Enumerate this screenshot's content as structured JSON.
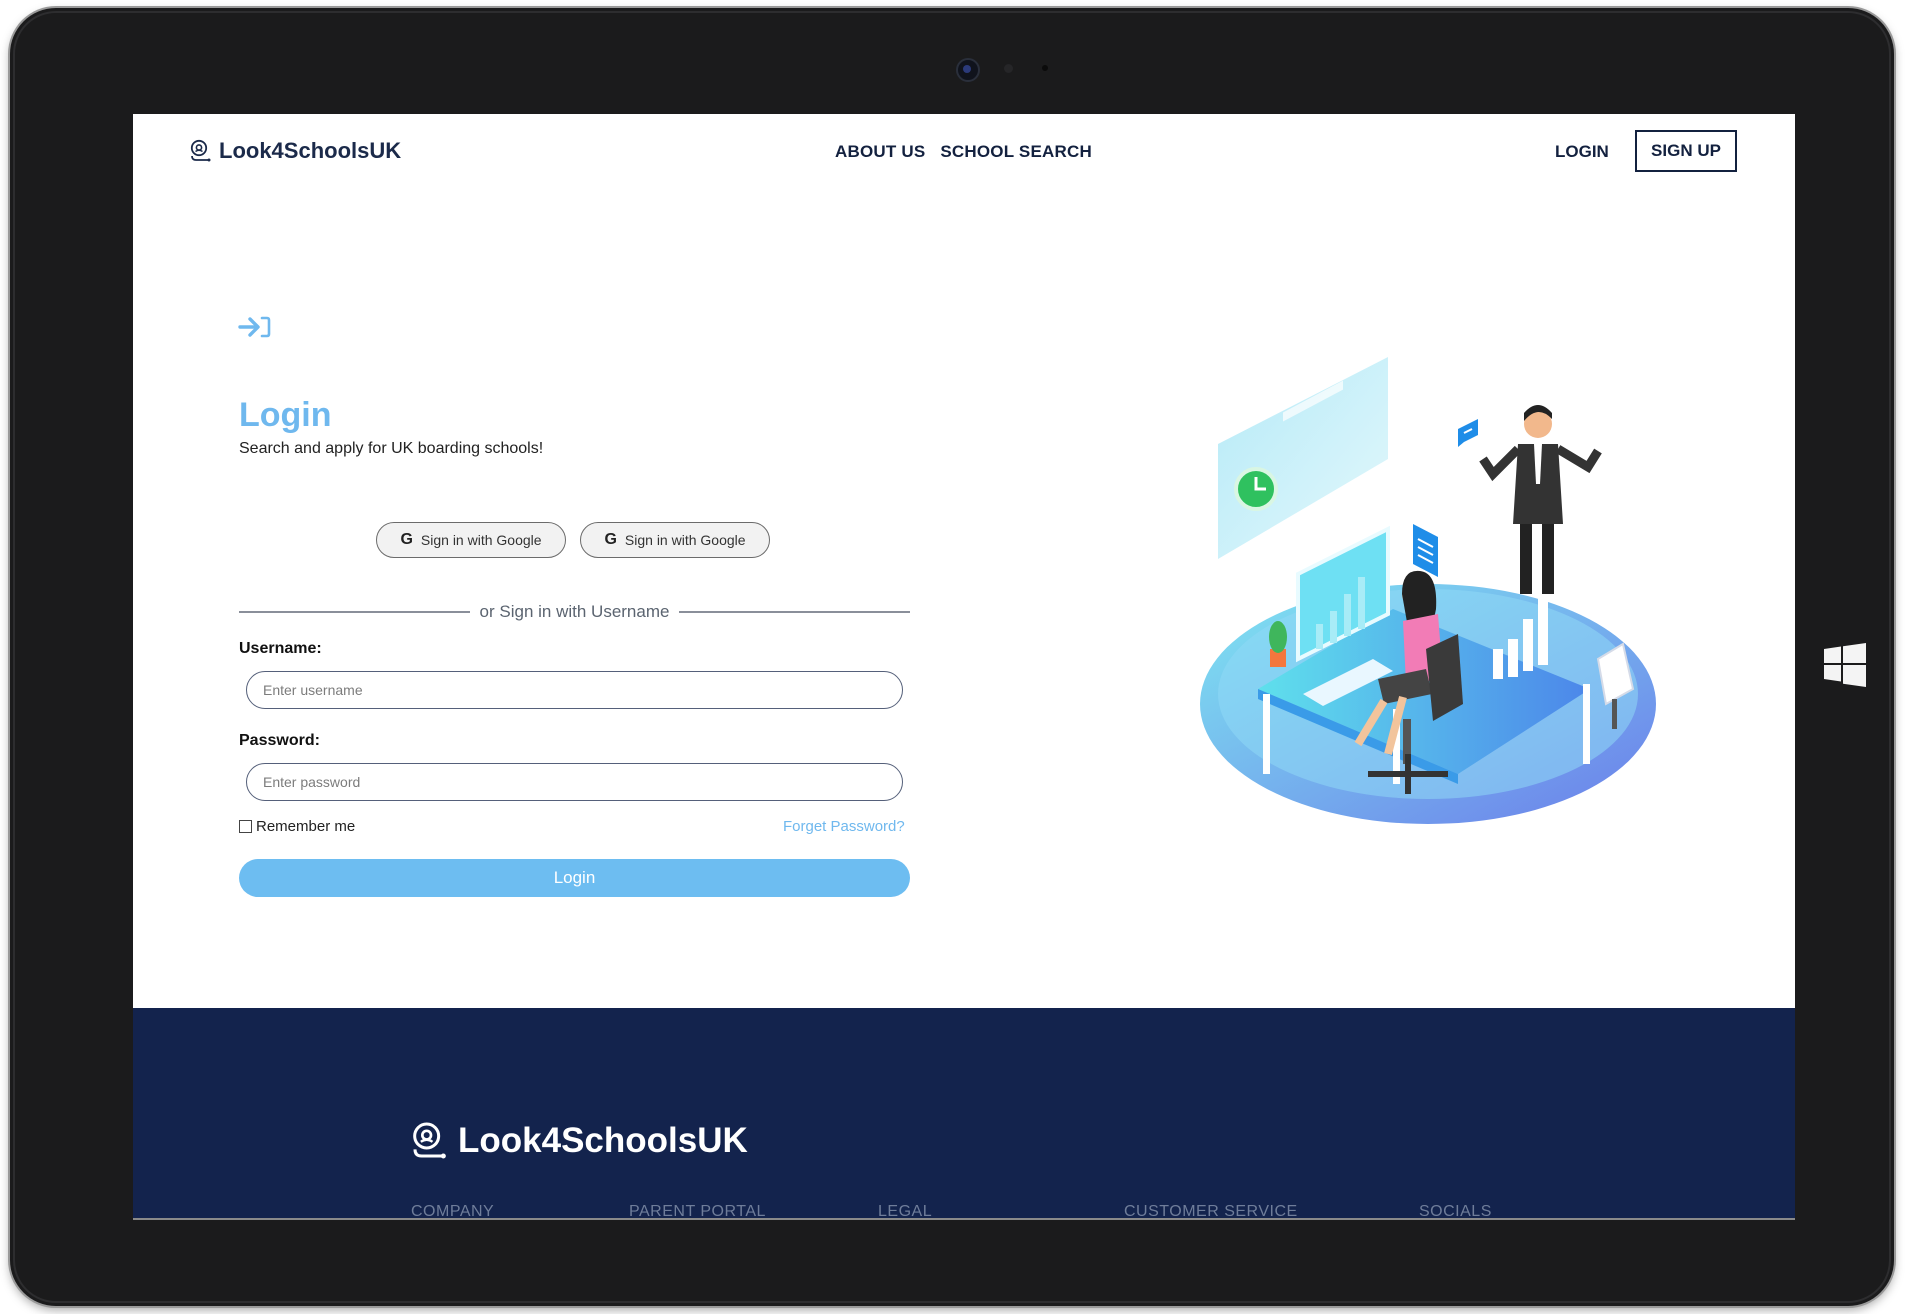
{
  "header": {
    "brand": "Look4SchoolsUK",
    "nav": [
      "ABOUT US",
      "SCHOOL SEARCH"
    ],
    "login": "LOGIN",
    "signup": "SIGN UP"
  },
  "login": {
    "title": "Login",
    "subtitle": "Search and apply for UK boarding schools!",
    "google_buttons": [
      "Sign in with Google",
      "Sign in with Google"
    ],
    "divider": "or Sign in with Username",
    "username_label": "Username:",
    "username_placeholder": "Enter username",
    "password_label": "Password:",
    "password_placeholder": "Enter password",
    "remember": "Remember me",
    "forgot": "Forget Password?",
    "submit": "Login"
  },
  "footer": {
    "brand": "Look4SchoolsUK",
    "columns": [
      "COMPANY",
      "PARENT PORTAL",
      "LEGAL",
      "CUSTOMER SERVICE",
      "SOCIALS"
    ]
  },
  "colors": {
    "accent": "#6dbdf1",
    "navy": "#13234d",
    "text": "#13213f"
  },
  "icons": [
    "pin-logo-icon",
    "sign-in-arrow-icon",
    "google-g-icon",
    "windows-logo-icon"
  ]
}
